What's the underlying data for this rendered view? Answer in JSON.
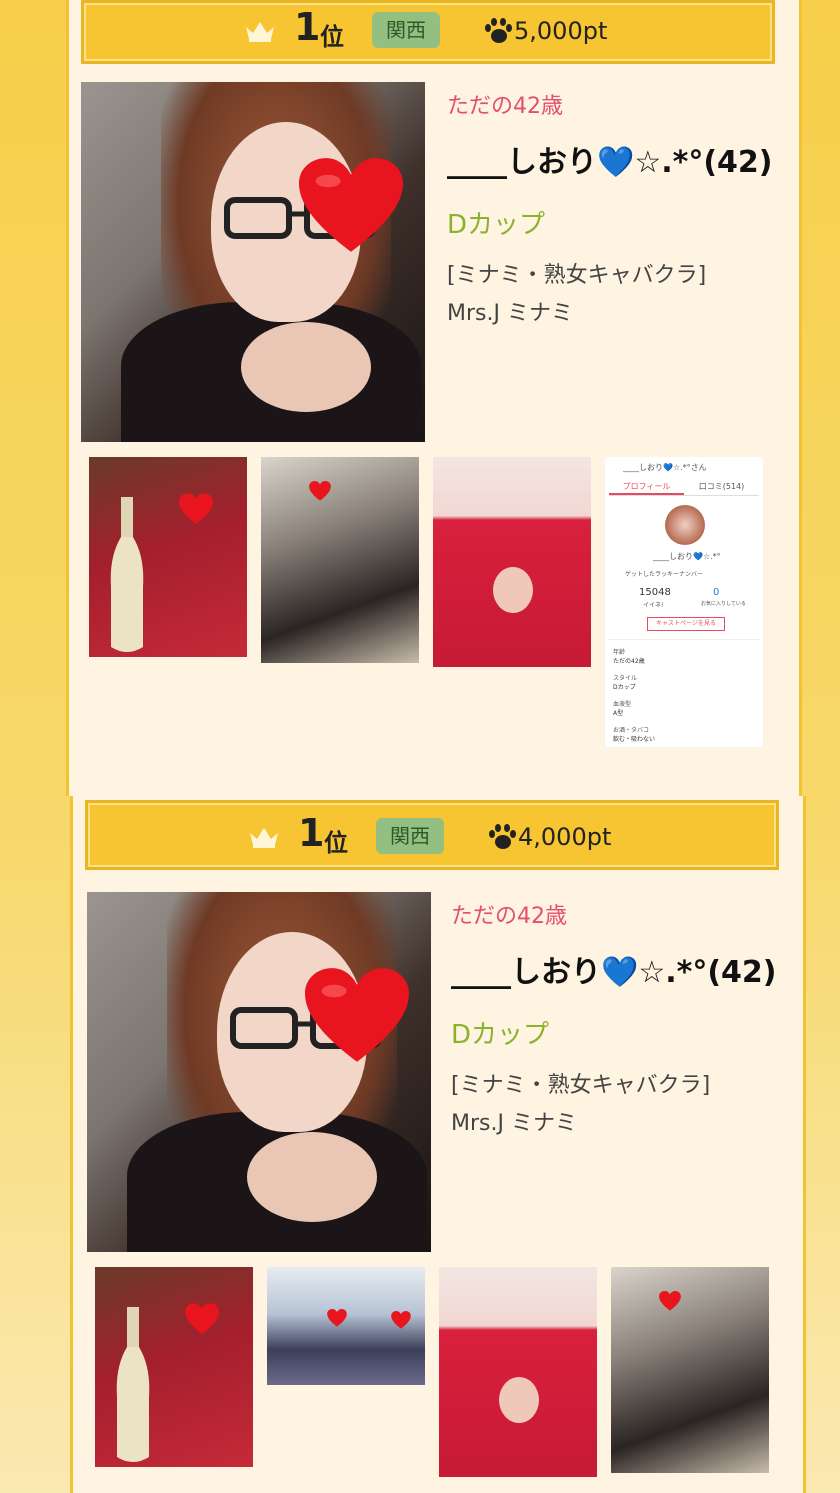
{
  "colors": {
    "page_bg": "#f7cf4a",
    "card_bg": "#fff4e2",
    "rank_bar": "#f6c531",
    "region_badge": "#93c080",
    "age_text": "#e2506a",
    "cup_text": "#8bb22c"
  },
  "rankings": [
    {
      "rank_number": "1",
      "rank_suffix": "位",
      "region": "関西",
      "points": "5,000pt",
      "age": "ただの42歳",
      "name": "____しおり💙☆.*°(42)",
      "cup": "Dカップ",
      "shop_category": "[ミナミ・熟女キャバクラ]",
      "shop_name": "Mrs.J ミナミ",
      "thumbnails": [
        "champagne-red-dress",
        "black-lingerie-sofa",
        "red-knit-dress",
        "profile-screenshot"
      ],
      "profile_screenshot": {
        "title": "____しおり💙☆.*°さん",
        "tab_profile": "プロフィール",
        "tab_reviews": "口コミ(514)",
        "avatar_name": "____しおり💙☆.*°",
        "points_label": "ゲットしたラッキーナンバー",
        "stat1_value": "15048",
        "stat1_label": "イイネ!",
        "stat2_value": "0",
        "stat2_label": "お気に入りしている",
        "button": "キャストページを見る",
        "field1_label": "年齢",
        "field1_value": "ただの42歳",
        "field2_label": "スタイル",
        "field2_value": "Dカップ",
        "field3_label": "血液型",
        "field3_value": "A型",
        "field4_label": "お酒・タバコ",
        "field4_value": "飲む・吸わない"
      }
    },
    {
      "rank_number": "1",
      "rank_suffix": "位",
      "region": "関西",
      "points": "4,000pt",
      "age": "ただの42歳",
      "name": "____しおり💙☆.*°(42)",
      "cup": "Dカップ",
      "shop_category": "[ミナミ・熟女キャバクラ]",
      "shop_name": "Mrs.J ミナミ",
      "thumbnails": [
        "champagne-red-dress",
        "party-group",
        "red-knit-dress",
        "black-lingerie-sofa"
      ]
    }
  ]
}
